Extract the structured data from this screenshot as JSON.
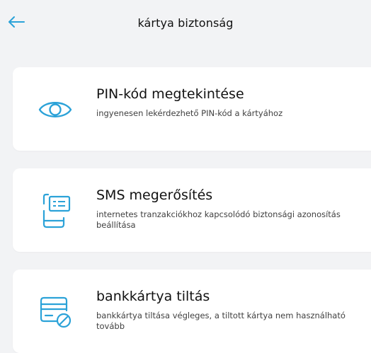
{
  "header": {
    "title": "kártya biztonság",
    "back_icon": "arrow-left-icon"
  },
  "colors": {
    "accent": "#2ba2d8",
    "background": "#f2f3f5",
    "card": "#ffffff"
  },
  "options": [
    {
      "title": "PIN-kód megtekintése",
      "description": "ingyenesen lekérdezhető PIN-kód a kártyához",
      "icon": "eye-icon"
    },
    {
      "title": "SMS megerősítés",
      "description": "internetes tranzakciókhoz kapcsolódó biztonsági azonosítás beállítása",
      "icon": "phone-message-icon"
    },
    {
      "title": "bankkártya tiltás",
      "description": "bankkártya tiltása végleges, a tiltott kártya nem használható tovább",
      "icon": "card-block-icon"
    }
  ]
}
